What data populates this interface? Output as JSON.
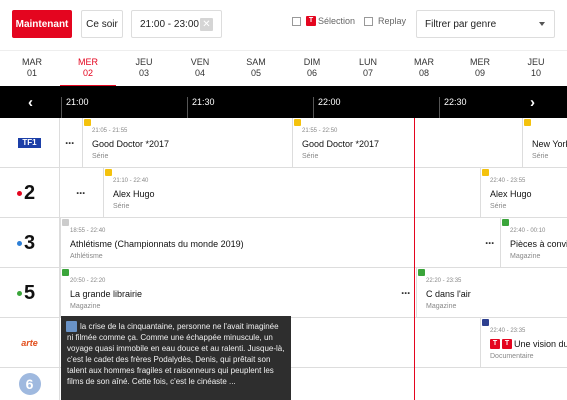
{
  "toolbar": {
    "now_label": "Maintenant",
    "tonight_label": "Ce soir",
    "time_range": "21:00 - 23:00",
    "clear_icon": "close-icon",
    "selection_label": "Sélection",
    "replay_label": "Replay",
    "genre_placeholder": "Filtrer par genre",
    "accent": "#e4051f"
  },
  "days": [
    {
      "name": "MAR",
      "num": "01",
      "active": false
    },
    {
      "name": "MER",
      "num": "02",
      "active": true
    },
    {
      "name": "JEU",
      "num": "03",
      "active": false
    },
    {
      "name": "VEN",
      "num": "04",
      "active": false
    },
    {
      "name": "SAM",
      "num": "05",
      "active": false
    },
    {
      "name": "DIM",
      "num": "06",
      "active": false
    },
    {
      "name": "LUN",
      "num": "07",
      "active": false
    },
    {
      "name": "MAR",
      "num": "08",
      "active": false
    },
    {
      "name": "MER",
      "num": "09",
      "active": false
    },
    {
      "name": "JEU",
      "num": "10",
      "active": false
    }
  ],
  "timeline": {
    "labels": [
      "21:00",
      "21:30",
      "22:00",
      "22:30"
    ],
    "prev_icon": "chevron-left-icon",
    "next_icon": "chevron-right-icon"
  },
  "channels": [
    {
      "logo": "TF1",
      "programs": [
        {
          "time": "21:05 - 21:55",
          "name": "Good Doctor *2017",
          "genre": "Série",
          "rating": "#f4c20d"
        },
        {
          "time": "21:55 - 22:50",
          "name": "Good Doctor *2017",
          "genre": "Série",
          "rating": "#f4c20d"
        },
        {
          "time": "",
          "name": "New York",
          "genre": "Série",
          "rating": "#f4c20d"
        }
      ]
    },
    {
      "logo": "2",
      "programs": [
        {
          "time": "21:10 - 22:40",
          "name": "Alex Hugo",
          "genre": "Série",
          "rating": "#f4c20d"
        },
        {
          "time": "22:40 - 23:55",
          "name": "Alex Hugo",
          "genre": "Série",
          "rating": "#f4c20d"
        }
      ]
    },
    {
      "logo": "3",
      "programs": [
        {
          "time": "18:55 - 22:40",
          "name": "Athlétisme (Championnats du monde 2019)",
          "genre": "Athlétisme",
          "rating": "#cccccc"
        },
        {
          "time": "22:40 - 00:10",
          "name": "Pièces à convic",
          "genre": "Magazine",
          "rating": "#3aa53a"
        }
      ]
    },
    {
      "logo": "5",
      "programs": [
        {
          "time": "20:50 - 22:20",
          "name": "La grande librairie",
          "genre": "Magazine",
          "rating": "#3aa53a"
        },
        {
          "time": "22:20 - 23:35",
          "name": "C dans l'air",
          "genre": "Magazine",
          "rating": "#3aa53a"
        }
      ]
    },
    {
      "logo": "arte",
      "programs": [
        {
          "time": "22:40 - 23:35",
          "name": "Une vision du fu",
          "genre": "Documentaire",
          "rating": "#2d3f8f"
        }
      ]
    },
    {
      "logo": "6",
      "programs": []
    }
  ],
  "tooltip": {
    "text": "la crise de la cinquantaine, personne ne l'avait imaginée ni filmée comme ça. Comme une échappée minuscule, un voyage quasi immobile en eau douce et au ralenti. Jusque-là, c'est le cadet des frères Podalydès, Denis, qui prêtait son talent aux hommes fragiles et raisonneurs qui peuplent les films de son aîné. Cette fois, c'est le cinéaste ..."
  }
}
